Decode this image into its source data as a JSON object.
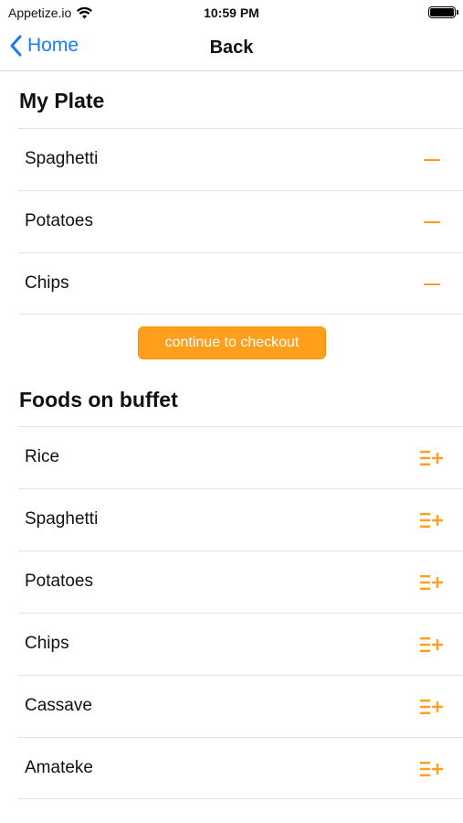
{
  "status_bar": {
    "carrier": "Appetize.io",
    "time": "10:59 PM"
  },
  "nav": {
    "back_label": "Home",
    "title": "Back"
  },
  "plate": {
    "title": "My Plate",
    "items": [
      {
        "label": "Spaghetti"
      },
      {
        "label": "Potatoes"
      },
      {
        "label": "Chips"
      }
    ]
  },
  "checkout_label": "continue to checkout",
  "buffet": {
    "title": "Foods on buffet",
    "items": [
      {
        "label": "Rice"
      },
      {
        "label": "Spaghetti"
      },
      {
        "label": "Potatoes"
      },
      {
        "label": "Chips"
      },
      {
        "label": "Cassave"
      },
      {
        "label": "Amateke"
      }
    ]
  },
  "colors": {
    "accent": "#ff9f1c",
    "link": "#1a7cf5"
  },
  "icons": {
    "remove": "minus-icon",
    "add": "add-to-list-icon"
  }
}
